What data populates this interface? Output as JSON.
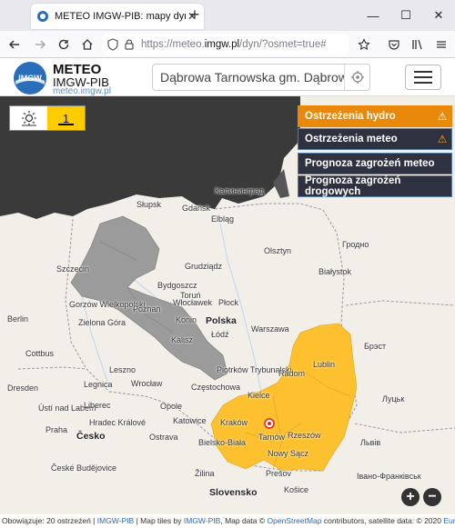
{
  "browser": {
    "tab_title": "METEO IMGW-PIB: mapy dynam",
    "url_prefix": "https://meteo.",
    "url_domain": "imgw.pl",
    "url_rest": "/dyn/?osmet=true#"
  },
  "site": {
    "brand_name": "METEO",
    "brand_org": "IMGW-PIB",
    "brand_url": "meteo.imgw.pl",
    "logo_text": "IMGW",
    "search_value": "Dąbrowa Tarnowska gm. Dąbrowa T"
  },
  "map_controls": {
    "level_value": "1",
    "panel": [
      {
        "label": "Ostrzeżenia hydro",
        "warn": true,
        "active": true
      },
      {
        "label": "Ostrzeżenia meteo",
        "warn": true,
        "active": false
      },
      {
        "label": "Prognoza zagrożeń meteo",
        "warn": false,
        "active": false
      },
      {
        "label": "Prognoza zagrożeń drogowych",
        "warn": false,
        "active": false
      }
    ],
    "zoom_in": "+",
    "zoom_out": "−",
    "warning_symbol": "⚠"
  },
  "map_labels": {
    "kaliningrad": "Калининград",
    "gdansk": "Gdańsk",
    "elblag": "Elbląg",
    "slupsk": "Słupsk",
    "olsztyn": "Olsztyn",
    "grodno": "Гродно",
    "bialystok": "Białystok",
    "szczecin": "Szczecin",
    "grudziadz": "Grudziądz",
    "bydgoszcz": "Bydgoszcz",
    "gorzow": "Gorzów Wielkopolski",
    "torun": "Toruń",
    "plock": "Płock",
    "poznan": "Poznań",
    "wloclawek": "Włocławek",
    "konin": "Konin",
    "polska": "Polska",
    "warszawa": "Warszawa",
    "berlin": "Berlin",
    "zielona_gora": "Zielona Góra",
    "kalisz": "Kalisz",
    "lodz": "Łódź",
    "brest": "Брэст",
    "lublin": "Lublin",
    "cottbus": "Cottbus",
    "leszno": "Leszno",
    "piotrkow": "Piotrków Trybunalski",
    "radom": "Radom",
    "legnica": "Legnica",
    "wroclaw": "Wrocław",
    "czestochowa": "Częstochowa",
    "dresden": "Dresden",
    "kielce": "Kielce",
    "luck": "Луцьк",
    "usti": "Ústí nad Labem",
    "opole": "Opole",
    "liberec": "Liberec",
    "katowice": "Katowice",
    "hradec": "Hradec Králové",
    "krakow": "Kraków",
    "tarnow": "Tarnów",
    "rzeszow": "Rzeszów",
    "lviv": "Львів",
    "praha": "Praha",
    "ostrava": "Ostrava",
    "bielsko": "Bielsko-Biała",
    "nowy_sacz": "Nowy Sącz",
    "cesko": "Česko",
    "budejovice": "České Budějovice",
    "zilina": "Žilina",
    "presov": "Prešov",
    "ivano": "Івано-Франківськ",
    "slovensko": "Slovensko",
    "kosice": "Košice"
  },
  "footer": {
    "text_a": "Obowiązuje: 20 ostrzeżeń | ",
    "link_a": "IMGW-PIB",
    "text_b": " | Map tiles by ",
    "link_b": "IMGW-PIB",
    "text_c": ", Map data © ",
    "link_c": "OpenStreetMap",
    "text_d": " contributors, satellite data: © 2020 ",
    "link_d": "Eumetsat"
  },
  "colors": {
    "warning_fill": "#fdc130",
    "gray_fill": "#9b9b9b",
    "sea": "#3a3a3a",
    "active_tab": "#e8890c",
    "panel_bg": "#2d3140"
  }
}
